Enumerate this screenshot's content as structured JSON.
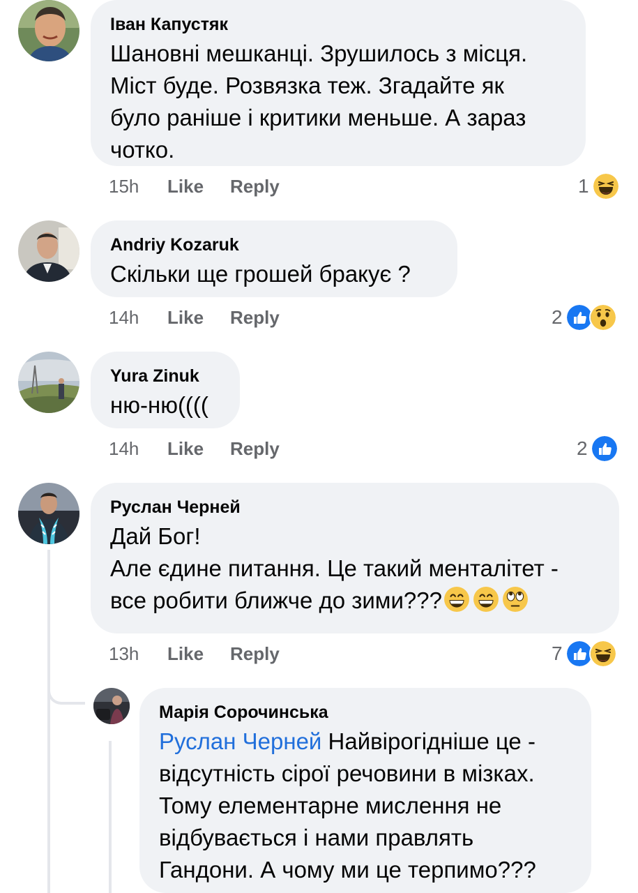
{
  "comments": [
    {
      "author": "Іван Капустяк",
      "text": "Шановні мешканці. Зрушилось з місця.\nМіст буде. Розвязка теж. Згадайте як\nбуло раніше і критики меньше. А зараз\nчотко.",
      "time": "15h",
      "like_label": "Like",
      "reply_label": "Reply",
      "reaction_count": "1",
      "reactions": [
        "haha-icon"
      ]
    },
    {
      "author": "Andriy Kozaruk",
      "text": "Скільки ще грошей бракує ?",
      "time": "14h",
      "like_label": "Like",
      "reply_label": "Reply",
      "reaction_count": "2",
      "reactions": [
        "like-icon",
        "wow-icon"
      ]
    },
    {
      "author": "Yura Zinuk",
      "text": "ню-ню((((",
      "time": "14h",
      "like_label": "Like",
      "reply_label": "Reply",
      "reaction_count": "2",
      "reactions": [
        "like-icon"
      ]
    },
    {
      "author": "Руслан Черней",
      "text": "Дай Бог!\nАле єдине питання. Це такий менталітет -\nвсе робити ближче до зими???",
      "emoji": [
        "grin-emoji",
        "grin-emoji",
        "eye-roll-emoji"
      ],
      "time": "13h",
      "like_label": "Like",
      "reply_label": "Reply",
      "reaction_count": "7",
      "reactions": [
        "like-icon",
        "haha-icon"
      ]
    }
  ],
  "reply": {
    "author": "Марія Сорочинська",
    "mention": "Руслан Черней",
    "text": " Найвірогідніше це -\nвідсутність сірої речовини в мізках.\nТому елементарне мислення не\nвідбувається і нами правлять\nГандони. А чому ми це терпимо???"
  },
  "colors": {
    "bubble": "#f0f2f5",
    "mention": "#216fdb",
    "meta": "#65676b",
    "like_blue": "#1877f2",
    "emoji_yellow": "#f7c74a"
  }
}
